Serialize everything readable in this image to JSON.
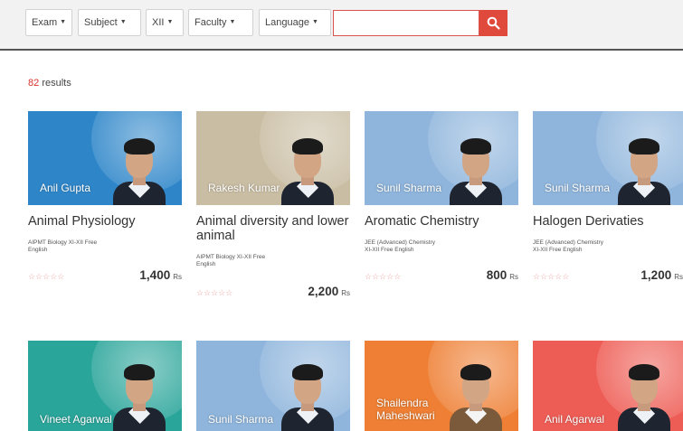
{
  "filters": [
    {
      "label": "Exam"
    },
    {
      "label": "Subject"
    },
    {
      "label": "XII"
    },
    {
      "label": "Faculty"
    },
    {
      "label": "Language"
    }
  ],
  "search": {
    "value": "",
    "placeholder": ""
  },
  "results": {
    "count": "82",
    "label": "results"
  },
  "courses": [
    {
      "title": "Animal Physiology",
      "teacher": "Anil Gupta",
      "tags": "AIPMT  Biology  XI-XII  Free\nEnglish",
      "price": "1,400",
      "currency": "Rs",
      "bg": "#2e86c9"
    },
    {
      "title": "Animal diversity and lower animal",
      "teacher": "Rakesh Kumar",
      "tags": "AIPMT  Biology  XI-XII  Free\nEnglish",
      "price": "2,200",
      "currency": "Rs",
      "bg": "#c9bda3"
    },
    {
      "title": "Aromatic Chemistry",
      "teacher": "Sunil Sharma",
      "tags": "JEE (Advanced)  Chemistry\nXI-XII  Free  English",
      "price": "800",
      "currency": "Rs",
      "bg": "#8fb5dc"
    },
    {
      "title": "Halogen Derivaties",
      "teacher": "Sunil Sharma",
      "tags": "JEE (Advanced)  Chemistry\nXI-XII  Free  English",
      "price": "1,200",
      "currency": "Rs",
      "bg": "#8fb5dc"
    },
    {
      "title": "",
      "teacher": "Vineet Agarwal",
      "tags": "",
      "price": "",
      "currency": "",
      "bg": "#2aa59a"
    },
    {
      "title": "",
      "teacher": "Sunil Sharma",
      "tags": "",
      "price": "",
      "currency": "",
      "bg": "#8fb5dc"
    },
    {
      "title": "",
      "teacher": "Shailendra Maheshwari",
      "tags": "",
      "price": "",
      "currency": "",
      "bg": "#ee7f34"
    },
    {
      "title": "",
      "teacher": "Anil Agarwal",
      "tags": "",
      "price": "",
      "currency": "",
      "bg": "#ee5d55"
    }
  ],
  "stars": "☆☆☆☆☆",
  "colors": {
    "accent": "#e04a3d",
    "results_count": "#d9302c",
    "stars": "#f0a7a3"
  },
  "icons": {
    "search": "search-icon",
    "dropdown": "caret-down-icon"
  }
}
